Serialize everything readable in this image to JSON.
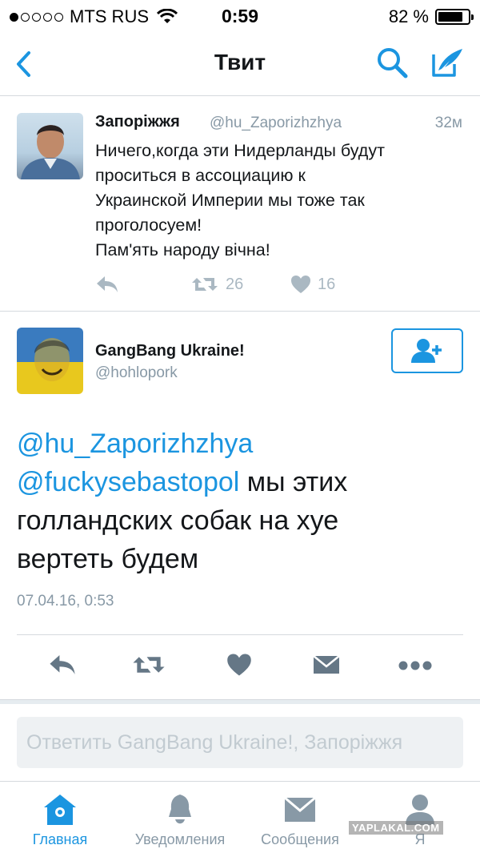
{
  "status_bar": {
    "carrier": "MTS RUS",
    "time": "0:59",
    "battery": "82 %",
    "battery_level": 0.82,
    "signal_bars": 1
  },
  "nav": {
    "title": "Твит"
  },
  "tweet1": {
    "name": "Запоріжжя",
    "handle": "@hu_Zaporizhzhya",
    "time": "32м",
    "lines": [
      "Ничего,когда эти Нидерланды будут",
      "проситься в ассоциацию к",
      "Украинской Империи мы тоже так",
      "проголосуем!",
      "Пам'ять народу вічна!"
    ],
    "retweets": "26",
    "likes": "16"
  },
  "tweet2": {
    "name": "GangBang Ukraine!",
    "handle": "@hohlopork",
    "mention1": "@hu_Zaporizhzhya",
    "mention2": "@fuckysebastopol",
    "line2_rest": " мы этих",
    "line3": "голландских собак на хуе",
    "line4": "вертеть будем",
    "date": "07.04.16, 0:53"
  },
  "reply": {
    "placeholder": "Ответить GangBang Ukraine!, Запоріжжя"
  },
  "tabs": [
    {
      "label": "Главная",
      "icon": "home-icon",
      "active": true
    },
    {
      "label": "Уведомления",
      "icon": "bell-icon",
      "active": false
    },
    {
      "label": "Сообщения",
      "icon": "envelope-icon",
      "active": false
    },
    {
      "label": "Я",
      "icon": "person-icon",
      "active": false
    }
  ],
  "watermark": "YAPLAKAL.COM",
  "colors": {
    "accent": "#1b95e0",
    "muted": "#8899a6",
    "icon_gray": "#aab8c2",
    "action_dark": "#657786"
  }
}
